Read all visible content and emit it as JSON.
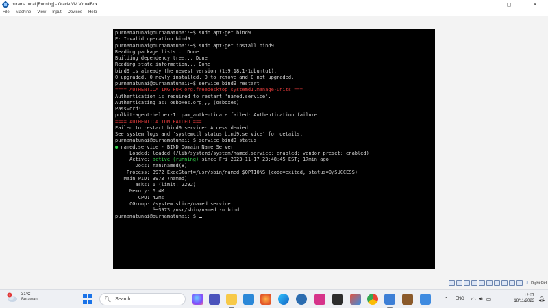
{
  "window": {
    "title": "purama tunai [Running] - Oracle VM VirtualBox",
    "minimize": "—",
    "maximize": "▢",
    "close": "✕"
  },
  "menu": [
    "File",
    "Machine",
    "View",
    "Input",
    "Devices",
    "Help"
  ],
  "terminal": {
    "lines": [
      {
        "text": "purnamatunai@purnamatunai:~$ sudo apt-get bind9",
        "color": ""
      },
      {
        "text": "E: Invalid operation bind9",
        "color": ""
      },
      {
        "text": "purnamatunai@purnamatunai:~$ sudo apt-get install bind9",
        "color": ""
      },
      {
        "text": "Reading package lists... Done",
        "color": ""
      },
      {
        "text": "Building dependency tree... Done",
        "color": ""
      },
      {
        "text": "Reading state information... Done",
        "color": ""
      },
      {
        "text": "bind9 is already the newest version (1:9.18.1-1ubuntu1).",
        "color": ""
      },
      {
        "text": "0 upgraded, 0 newly installed, 0 to remove and 0 not upgraded.",
        "color": ""
      },
      {
        "text": "purnamatunai@purnamatunai:~$ service bind9 restart",
        "color": ""
      },
      {
        "text": "==== AUTHENTICATING FOR org.freedesktop.systemd1.manage-units ===",
        "color": "red"
      },
      {
        "text": "Authentication is required to restart 'named.service'.",
        "color": ""
      },
      {
        "text": "Authenticating as: osboxes.org,,, (osboxes)",
        "color": ""
      },
      {
        "text": "Password:",
        "color": ""
      },
      {
        "text": "polkit-agent-helper-1: pam_authenticate failed: Authentication failure",
        "color": ""
      },
      {
        "text": "==== AUTHENTICATION FAILED ===",
        "color": "red"
      },
      {
        "text": "Failed to restart bind9.service: Access denied",
        "color": ""
      },
      {
        "text": "See system logs and 'systemctl status bind9.service' for details.",
        "color": ""
      },
      {
        "text": "purnamatunai@purnamatunai:~$ service bind9 status",
        "color": ""
      },
      {
        "text": "● named.service - BIND Domain Name Server",
        "color": ""
      },
      {
        "text": "     Loaded: loaded (/lib/systemd/system/named.service; enabled; vendor preset: enabled)",
        "color": ""
      },
      {
        "text": "     Active: active (running) since Fri 2023-11-17 23:48:45 EST; 17min ago",
        "color": ""
      },
      {
        "text": "       Docs: man:named(8)",
        "color": ""
      },
      {
        "text": "    Process: 3972 ExecStart=/usr/sbin/named $OPTIONS (code=exited, status=0/SUCCESS)",
        "color": ""
      },
      {
        "text": "   Main PID: 3973 (named)",
        "color": ""
      },
      {
        "text": "      Tasks: 6 (limit: 2292)",
        "color": ""
      },
      {
        "text": "     Memory: 6.4M",
        "color": ""
      },
      {
        "text": "        CPU: 42ms",
        "color": ""
      },
      {
        "text": "     CGroup: /system.slice/named.service",
        "color": ""
      },
      {
        "text": "             └─3973 /usr/sbin/named -u bind",
        "color": ""
      },
      {
        "text": "purnamatunai@purnamatunai:~$ ",
        "color": ""
      }
    ],
    "active_prefix": "     Active: ",
    "active_status": "active (running)",
    "active_suffix": " since Fri 2023-11-17 23:48:45 EST; 17min ago",
    "status_bullet": "●",
    "status_rest": " named.service - BIND Domain Name Server"
  },
  "statusbar": {
    "host_key": "Right Ctrl"
  },
  "taskbar": {
    "weather_temp": "31°C",
    "weather_desc": "Berawan",
    "weather_badge": "1",
    "search_label": "Search",
    "language": "ENG",
    "time": "12:07",
    "date": "18/11/2023"
  },
  "colors": {
    "terminal_bg": "#000000",
    "terminal_fg": "#d0d0d0",
    "red": "#e23a3a",
    "green": "#32d04a",
    "windows_blue": "#1a73e8"
  }
}
